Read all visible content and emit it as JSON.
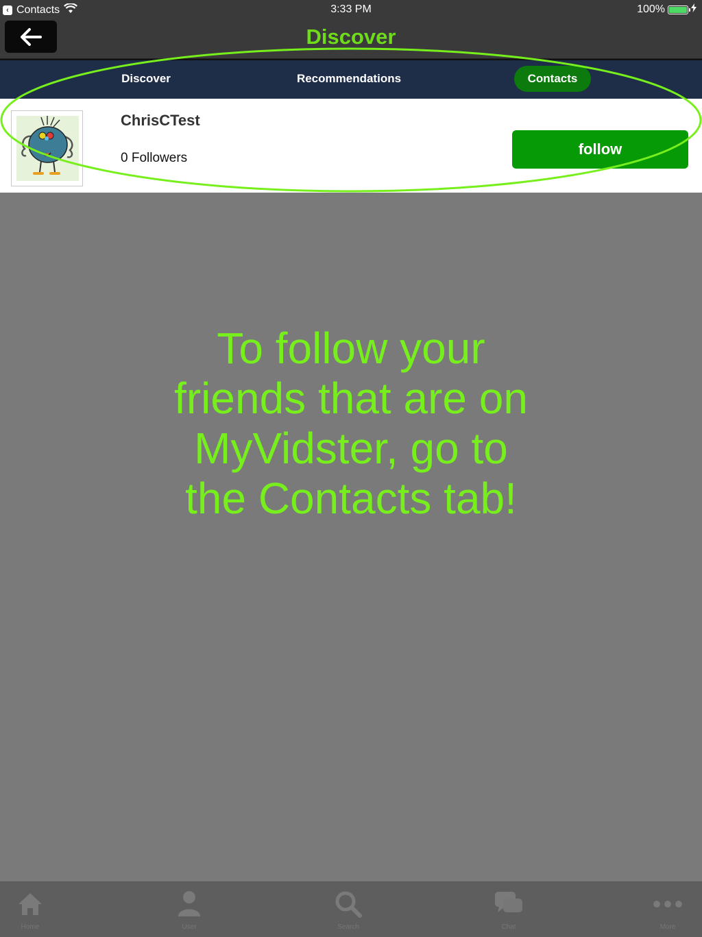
{
  "status_bar": {
    "back_app": "Contacts",
    "time": "3:33 PM",
    "battery": "100%",
    "battery_level": 1.0
  },
  "nav": {
    "title": "Discover",
    "back_icon": "arrow-left-icon"
  },
  "tabs": [
    {
      "label": "Discover",
      "active": false
    },
    {
      "label": "Recommendations",
      "active": false
    },
    {
      "label": "Contacts",
      "active": true
    }
  ],
  "contact": {
    "name": "ChrisCTest",
    "followers": "0 Followers",
    "follow_label": "follow"
  },
  "instruction": {
    "lines": [
      "To follow your",
      "friends that are on",
      "MyVidster, go to",
      "the Contacts tab!"
    ]
  },
  "bottom_tabs": [
    {
      "label": "Home",
      "icon": "home-icon"
    },
    {
      "label": "User",
      "icon": "user-icon"
    },
    {
      "label": "Search",
      "icon": "search-icon"
    },
    {
      "label": "Chat",
      "icon": "chat-icon"
    },
    {
      "label": "More",
      "icon": "more-icon"
    }
  ],
  "colors": {
    "accent_green": "#6edc1a",
    "annotation_green": "#77ef1c",
    "follow_button": "#079a07",
    "tab_bar": "#1f2e48",
    "active_tab": "#0d7a0d"
  }
}
